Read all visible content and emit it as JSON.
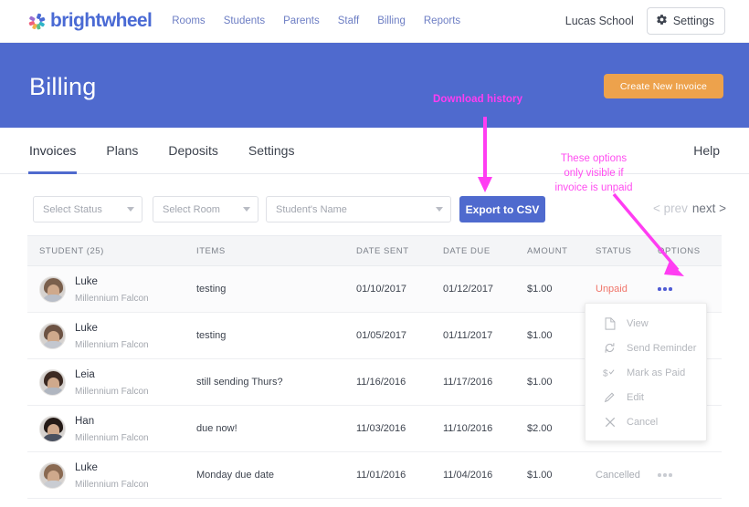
{
  "nav": {
    "logo_text": "brightwheel",
    "logo_icon": "pinwheel-icon",
    "links": [
      "Rooms",
      "Students",
      "Parents",
      "Staff",
      "Billing",
      "Reports"
    ],
    "school": "Lucas School",
    "settings_label": "Settings",
    "settings_icon": "gear-icon"
  },
  "banner": {
    "title": "Billing",
    "create_button": "Create New Invoice",
    "bg_color": "#4f6ace",
    "button_color": "#eda24c"
  },
  "tabs": {
    "items": [
      "Invoices",
      "Plans",
      "Deposits",
      "Settings"
    ],
    "active": "Invoices",
    "help_label": "Help"
  },
  "filters": {
    "status_placeholder": "Select Status",
    "room_placeholder": "Select Room",
    "name_placeholder": "Student's Name",
    "export_label": "Export to CSV",
    "prev_label": "< prev",
    "next_label": "next >"
  },
  "table": {
    "headers": [
      "STUDENT (25)",
      "ITEMS",
      "DATE SENT",
      "DATE DUE",
      "AMOUNT",
      "STATUS",
      "OPTIONS"
    ],
    "rows": [
      {
        "name": "Luke",
        "room": "Millennium Falcon",
        "items": "testing",
        "date_sent": "01/10/2017",
        "date_due": "01/12/2017",
        "amount": "$1.00",
        "status": "Unpaid",
        "status_kind": "unpaid",
        "options_icon": "kebab-menu-icon",
        "options_active": true
      },
      {
        "name": "Luke",
        "room": "Millennium Falcon",
        "items": "testing",
        "date_sent": "01/05/2017",
        "date_due": "01/11/2017",
        "amount": "$1.00",
        "status": "",
        "status_kind": "hidden",
        "options_icon": "kebab-menu-icon",
        "options_active": false
      },
      {
        "name": "Leia",
        "room": "Millennium Falcon",
        "items": "still sending Thurs?",
        "date_sent": "11/16/2016",
        "date_due": "11/17/2016",
        "amount": "$1.00",
        "status": "",
        "status_kind": "hidden",
        "options_icon": "kebab-menu-icon",
        "options_active": false
      },
      {
        "name": "Han",
        "room": "Millennium Falcon",
        "items": "due now!",
        "date_sent": "11/03/2016",
        "date_due": "11/10/2016",
        "amount": "$2.00",
        "status": "",
        "status_kind": "hidden",
        "options_icon": "kebab-menu-icon",
        "options_active": false
      },
      {
        "name": "Luke",
        "room": "Millennium Falcon",
        "items": "Monday due date",
        "date_sent": "11/01/2016",
        "date_due": "11/04/2016",
        "amount": "$1.00",
        "status": "Cancelled",
        "status_kind": "cancelled",
        "options_icon": "kebab-menu-icon",
        "options_active": false
      }
    ]
  },
  "options_menu": {
    "items": [
      {
        "label": "View",
        "icon": "document-icon"
      },
      {
        "label": "Send Reminder",
        "icon": "refresh-icon"
      },
      {
        "label": "Mark as Paid",
        "icon": "dollar-check-icon"
      },
      {
        "label": "Edit",
        "icon": "pencil-icon"
      },
      {
        "label": "Cancel",
        "icon": "close-x-icon"
      }
    ]
  },
  "annotations": {
    "download_history": "Download history",
    "options_note": "These options only visible if invoice is unpaid",
    "color": "#ff3df2"
  }
}
